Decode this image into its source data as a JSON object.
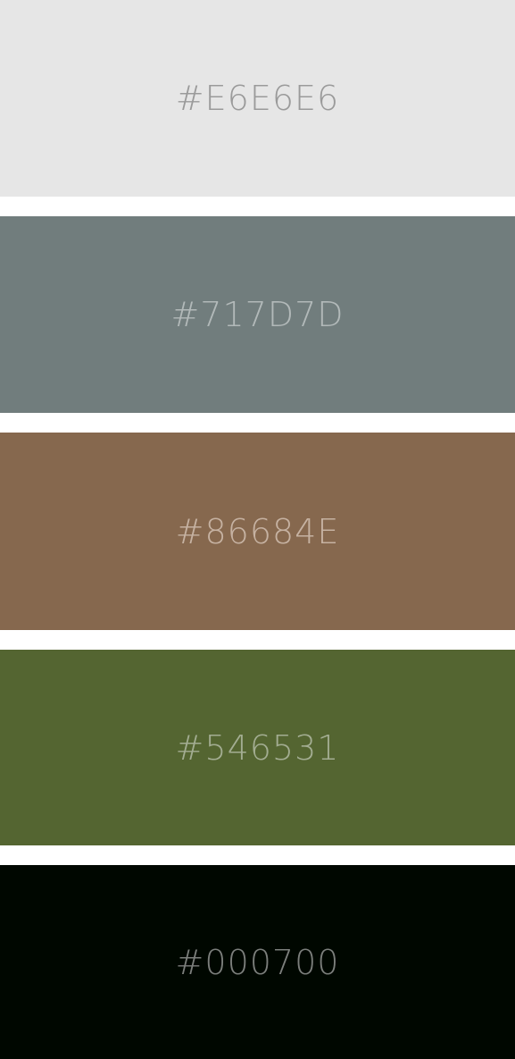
{
  "swatches": [
    {
      "hex_label": "#E6E6E6",
      "color": "#E6E6E6",
      "text_color": "#9A9A9A"
    },
    {
      "hex_label": "#717D7D",
      "color": "#717D7D",
      "text_color": "#B2B9B9"
    },
    {
      "hex_label": "#86684E",
      "color": "#86684E",
      "text_color": "#C6B2A2"
    },
    {
      "hex_label": "#546531",
      "color": "#546531",
      "text_color": "#A3AD92"
    },
    {
      "hex_label": "#000700",
      "color": "#000700",
      "text_color": "#7C7F7C"
    }
  ]
}
